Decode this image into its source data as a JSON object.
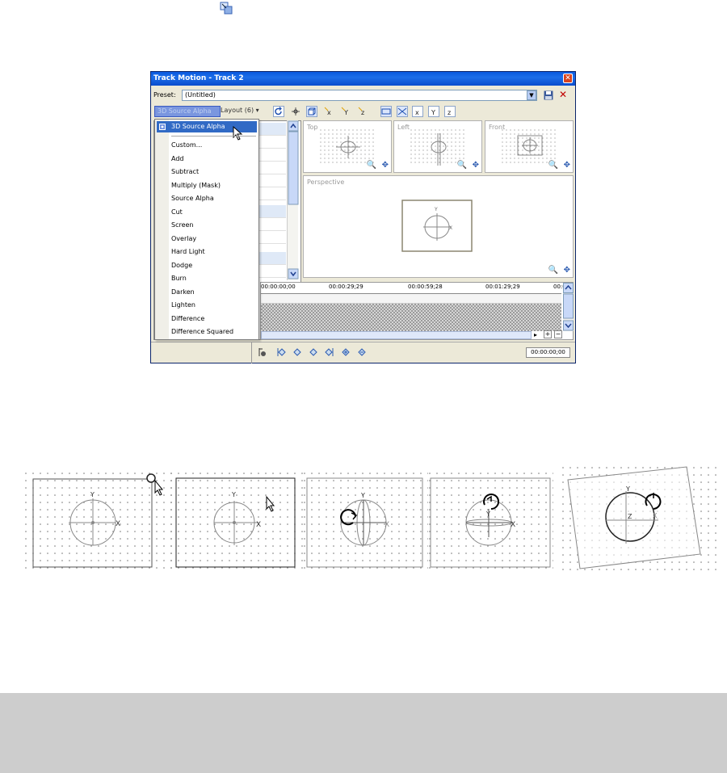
{
  "window": {
    "title": "Track Motion - Track 2",
    "close_glyph": "✕"
  },
  "preset": {
    "label": "Preset:",
    "value": "(Untitled)"
  },
  "toolbar": {
    "blend_mode": "3D Source Alpha",
    "layout_label": "Layout (6)"
  },
  "blend_menu": {
    "selected": "3D Source Alpha",
    "items": [
      "Custom...",
      "Add",
      "Subtract",
      "Multiply (Mask)",
      "Source Alpha",
      "Cut",
      "Screen",
      "Overlay",
      "Hard Light",
      "Dodge",
      "Burn",
      "Darken",
      "Lighten",
      "Difference",
      "Difference Squared"
    ]
  },
  "viewports": {
    "top": "Top",
    "left": "Left",
    "front": "Front",
    "perspective": "Perspective"
  },
  "timeline": {
    "ticks": [
      "00:00:00;00",
      "00:00:29;29",
      "00:00:59;28",
      "00:01:29;29",
      "00:0"
    ],
    "timecode": "00:00:00;00"
  },
  "axis_labels": {
    "x": "X",
    "y": "Y",
    "z": "Z"
  },
  "colors": {
    "title_bar": "#0a5adf",
    "menu_selection": "#316ac5",
    "window_bg": "#ece9d8"
  }
}
